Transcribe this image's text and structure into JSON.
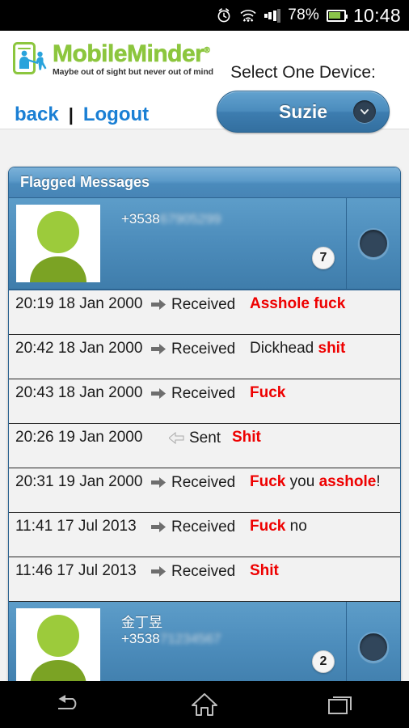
{
  "status_bar": {
    "alarm_icon": "alarm-clock-icon",
    "wifi_icon": "wifi-icon",
    "signal_icon": "signal-bars-icon",
    "battery_percent": "78%",
    "battery_icon": "battery-icon",
    "clock": "10:48"
  },
  "header": {
    "logo_icon": "mobileminder-logo-icon",
    "brand_name": "MobileMinder",
    "brand_reg": "®",
    "tagline": "Maybe out of sight but never out of mind",
    "back_link": "back",
    "divider": "|",
    "logout_link": "Logout",
    "device_label": "Select One Device:",
    "device_selected": "Suzie",
    "device_chevron_icon": "chevron-down-icon"
  },
  "panel": {
    "title": "Flagged Messages"
  },
  "contacts": [
    {
      "avatar_icon": "person-avatar-icon",
      "name": "",
      "number_visible": "+3538",
      "number_redacted": "67905299",
      "badge": "7",
      "toggle_icon": "collapse-toggle-icon",
      "expanded": true
    },
    {
      "avatar_icon": "person-avatar-icon",
      "name": "金丁昱",
      "number_visible": "+3538",
      "number_redacted": "71234567",
      "badge": "2",
      "toggle_icon": "expand-toggle-icon",
      "expanded": false
    }
  ],
  "messages": [
    {
      "time": "20:19 18 Jan 2000",
      "direction": "Received",
      "direction_icon": "arrow-right-received-icon",
      "parts": [
        {
          "text": "Asshole fuck",
          "flagged": true
        }
      ]
    },
    {
      "time": "20:42 18 Jan 2000",
      "direction": "Received",
      "direction_icon": "arrow-right-received-icon",
      "parts": [
        {
          "text": "Dickhead ",
          "flagged": false
        },
        {
          "text": "shit",
          "flagged": true
        }
      ]
    },
    {
      "time": "20:43 18 Jan 2000",
      "direction": "Received",
      "direction_icon": "arrow-right-received-icon",
      "parts": [
        {
          "text": "Fuck",
          "flagged": true
        }
      ]
    },
    {
      "time": "20:26 19 Jan 2000",
      "direction": "Sent",
      "direction_icon": "arrow-left-sent-icon",
      "parts": [
        {
          "text": "Shit",
          "flagged": true
        }
      ]
    },
    {
      "time": "20:31 19 Jan 2000",
      "direction": "Received",
      "direction_icon": "arrow-right-received-icon",
      "parts": [
        {
          "text": "Fuck",
          "flagged": true
        },
        {
          "text": " you ",
          "flagged": false
        },
        {
          "text": "asshole",
          "flagged": true
        },
        {
          "text": "!",
          "flagged": false
        }
      ]
    },
    {
      "time": "11:41 17 Jul 2013",
      "direction": "Received",
      "direction_icon": "arrow-right-received-icon",
      "parts": [
        {
          "text": "Fuck",
          "flagged": true
        },
        {
          "text": " no",
          "flagged": false
        }
      ]
    },
    {
      "time": "11:46 17 Jul 2013",
      "direction": "Received",
      "direction_icon": "arrow-right-received-icon",
      "parts": [
        {
          "text": "Shit",
          "flagged": true
        }
      ]
    }
  ],
  "nav_bar": {
    "back_icon": "back-icon",
    "home_icon": "home-icon",
    "recents_icon": "recents-icon"
  },
  "colors": {
    "brand_green": "#8cc63e",
    "brand_blue": "#1a7fd4",
    "panel_blue": "#4a8bbc",
    "flag_red": "#ee0000",
    "battery_green": "#8bc34a"
  }
}
